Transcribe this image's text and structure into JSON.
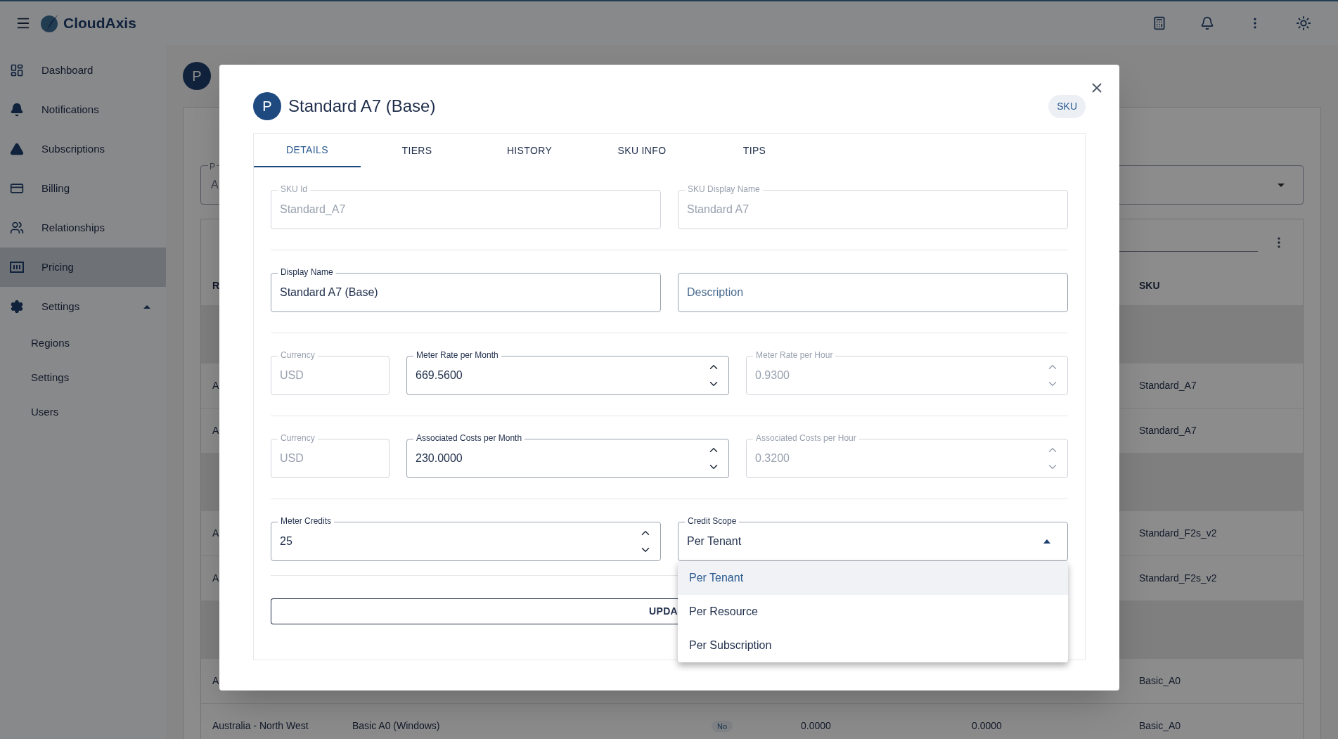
{
  "header": {
    "logo": "CloudAxis"
  },
  "sidebar": {
    "items": [
      {
        "label": "Dashboard",
        "selected": false
      },
      {
        "label": "Notifications",
        "selected": false
      },
      {
        "label": "Subscriptions",
        "selected": false
      },
      {
        "label": "Billing",
        "selected": false
      },
      {
        "label": "Relationships",
        "selected": false
      },
      {
        "label": "Pricing",
        "selected": true
      },
      {
        "label": "Settings",
        "selected": false,
        "expanded": true,
        "children": [
          {
            "label": "Regions"
          },
          {
            "label": "Settings"
          },
          {
            "label": "Users"
          }
        ]
      }
    ]
  },
  "page": {
    "avatar": "P",
    "filter": {
      "label": "P",
      "value": "A"
    },
    "table": {
      "columns": [
        "R",
        "SKU"
      ],
      "rows": [
        {
          "kind": "group"
        },
        {
          "kind": "data",
          "region": "A",
          "sku": "Standard_A7"
        },
        {
          "kind": "data",
          "region": "A",
          "sku": "Standard_A7"
        },
        {
          "kind": "group"
        },
        {
          "kind": "data",
          "region": "A",
          "sku": "Standard_F2s_v2"
        },
        {
          "kind": "data",
          "region": "A",
          "sku": "Standard_F2s_v2"
        },
        {
          "kind": "group"
        },
        {
          "kind": "data",
          "region": "A",
          "sku": "Basic_A0"
        },
        {
          "kind": "data",
          "region": "Australia - North West",
          "name": "Basic A0 (Windows)",
          "flag": "No",
          "cost_1": "0.0000",
          "cost_2": "0.0000",
          "sku": "Basic_A0"
        }
      ]
    }
  },
  "dialog": {
    "avatar": "P",
    "title": "Standard A7 (Base)",
    "badge": "SKU",
    "tabs": [
      {
        "label": "DETAILS",
        "selected": true
      },
      {
        "label": "TIERS",
        "selected": false
      },
      {
        "label": "HISTORY",
        "selected": false
      },
      {
        "label": "SKU INFO",
        "selected": false
      },
      {
        "label": "TIPS",
        "selected": false
      }
    ],
    "rows": [
      [
        {
          "kind": "text",
          "label": "SKU Id",
          "value": "Standard_A7",
          "disabled": true
        },
        {
          "kind": "text",
          "label": "SKU Display Name",
          "value": "Standard A7",
          "disabled": true
        }
      ],
      [
        {
          "kind": "text",
          "label": "Display Name",
          "value": "Standard A7 (Base)",
          "disabled": false
        },
        {
          "kind": "text",
          "placeholder": "Description",
          "disabled": false
        }
      ],
      [
        {
          "kind": "text",
          "label": "Currency",
          "value": "USD",
          "disabled": true
        },
        {
          "kind": "number",
          "label": "Meter Rate per Month",
          "value": "669.5600",
          "disabled": false
        },
        {
          "kind": "number",
          "label": "Meter Rate per Hour",
          "value": "0.9300",
          "disabled": true
        }
      ],
      [
        {
          "kind": "text",
          "label": "Currency",
          "value": "USD",
          "disabled": true
        },
        {
          "kind": "number",
          "label": "Associated Costs per Month",
          "value": "230.0000",
          "disabled": false
        },
        {
          "kind": "number",
          "label": "Associated Costs per Hour",
          "value": "0.3200",
          "disabled": true
        }
      ],
      [
        {
          "kind": "number",
          "label": "Meter Credits",
          "value": "25",
          "disabled": false
        },
        {
          "kind": "select",
          "label": "Credit Scope",
          "value": "Per Tenant",
          "disabled": false,
          "expanded": true,
          "options": [
            {
              "label": "Per Tenant",
              "selected": true
            },
            {
              "label": "Per Resource",
              "selected": false
            },
            {
              "label": "Per Subscription",
              "selected": false
            }
          ]
        }
      ]
    ],
    "button": "UPDA"
  }
}
